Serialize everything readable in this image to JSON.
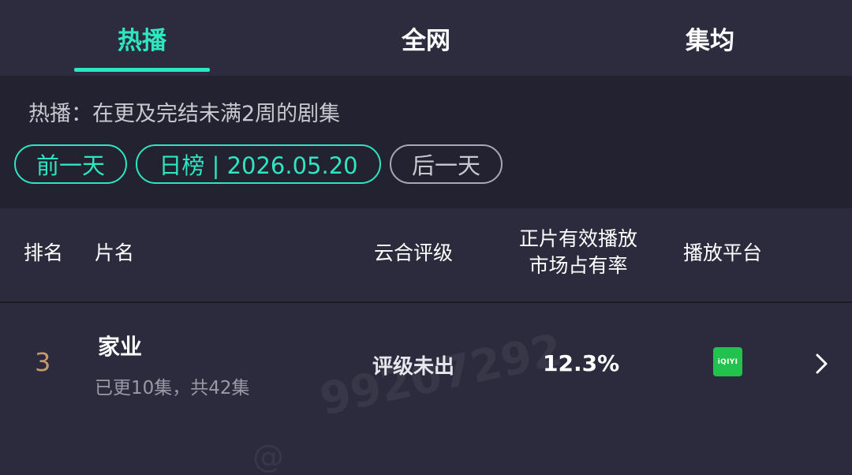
{
  "tabs": [
    {
      "label": "热播",
      "active": true
    },
    {
      "label": "全网",
      "active": false
    },
    {
      "label": "集均",
      "active": false
    }
  ],
  "filter": {
    "description": "热播：在更及完结未满2周的剧集",
    "prev_day": "前一天",
    "date_label": "日榜 | 2026.05.20",
    "next_day": "后一天"
  },
  "table": {
    "headers": {
      "rank": "排名",
      "title": "片名",
      "rating": "云合评级",
      "share_line1": "正片有效播放",
      "share_line2": "市场占有率",
      "platform": "播放平台"
    },
    "rows": [
      {
        "rank": "3",
        "title": "家业",
        "episodes": "已更10集，共42集",
        "rating": "评级未出",
        "share": "12.3%",
        "platform": "iQIYI",
        "platform_color": "#21c24d"
      }
    ]
  },
  "watermark": {
    "at": "@",
    "text": "99207292"
  },
  "colors": {
    "accent": "#2ee6c2",
    "background": "#2b2b3d",
    "rank": "#c79a6e"
  }
}
